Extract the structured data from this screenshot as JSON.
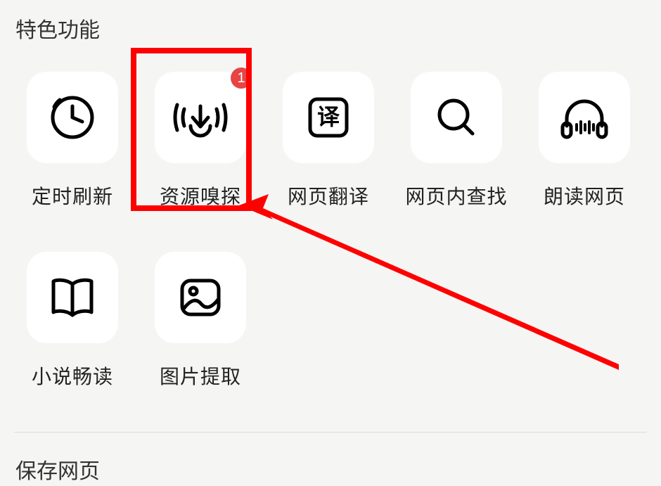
{
  "sections": {
    "features_title": "特色功能",
    "save_title": "保存网页"
  },
  "items": [
    {
      "name": "timed-refresh",
      "label": "定时刷新",
      "icon": "clock-icon",
      "badge": null
    },
    {
      "name": "resource-sniff",
      "label": "资源嗅探",
      "icon": "sniffer-icon",
      "badge": "1"
    },
    {
      "name": "page-translate",
      "label": "网页翻译",
      "icon": "translate-icon",
      "badge": null
    },
    {
      "name": "find-in-page",
      "label": "网页内查找",
      "icon": "search-icon",
      "badge": null
    },
    {
      "name": "read-aloud",
      "label": "朗读网页",
      "icon": "headphones-icon",
      "badge": null
    },
    {
      "name": "novel-read",
      "label": "小说畅读",
      "icon": "book-icon",
      "badge": null
    },
    {
      "name": "image-extract",
      "label": "图片提取",
      "icon": "image-icon",
      "badge": null
    }
  ],
  "annotation": {
    "highlight_item": "resource-sniff",
    "arrow_color": "#ff0000"
  }
}
